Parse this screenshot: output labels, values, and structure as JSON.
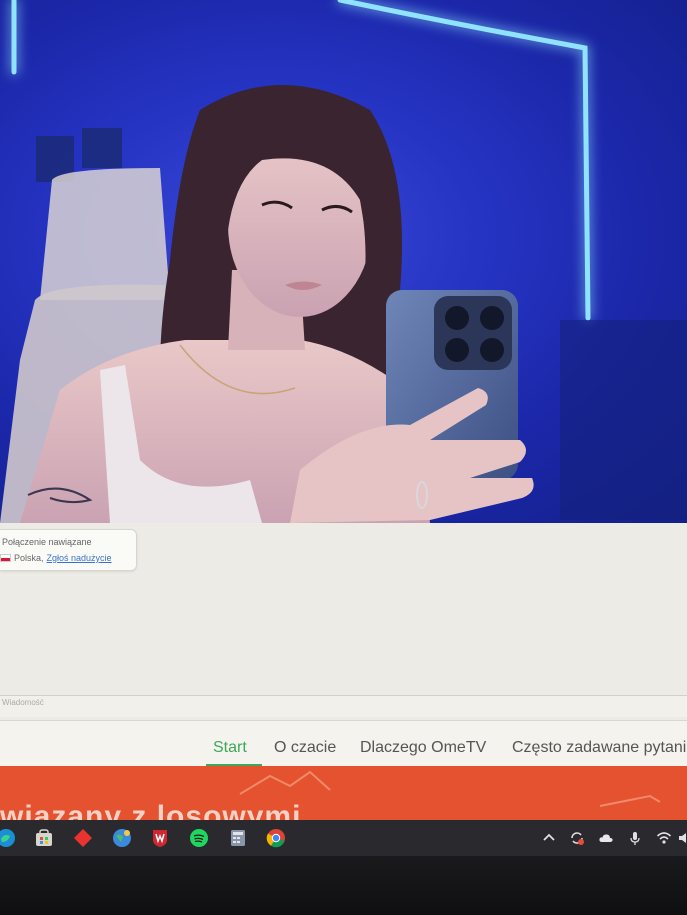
{
  "video": {
    "description_icon": "remote-video-feed"
  },
  "chat": {
    "status": "Połączenie nawiązane",
    "country": "Polska",
    "separator": ",",
    "report_link": "Zgłoś nadużycie",
    "input_placeholder": "Wiadomość"
  },
  "nav": {
    "items": [
      {
        "label": "Start",
        "active": true
      },
      {
        "label": "O czacie",
        "active": false
      },
      {
        "label": "Dlaczego OmeTV",
        "active": false
      },
      {
        "label": "Często zadawane pytania",
        "active": false
      }
    ]
  },
  "banner": {
    "text": "wiązany z losowymi"
  },
  "taskbar": {
    "apps": [
      "edge-icon",
      "store-icon",
      "gem-app-icon",
      "earth-app-icon",
      "mcafee-icon",
      "spotify-icon",
      "calculator-icon",
      "chrome-icon"
    ],
    "tray": [
      "chevron-up-icon",
      "sync-icon",
      "cloud-icon",
      "microphone-icon",
      "wifi-icon",
      "volume-icon"
    ]
  },
  "colors": {
    "accent_green": "#3ea85a",
    "banner_orange": "#e5522f",
    "neon_blue": "#7fd7ff"
  }
}
